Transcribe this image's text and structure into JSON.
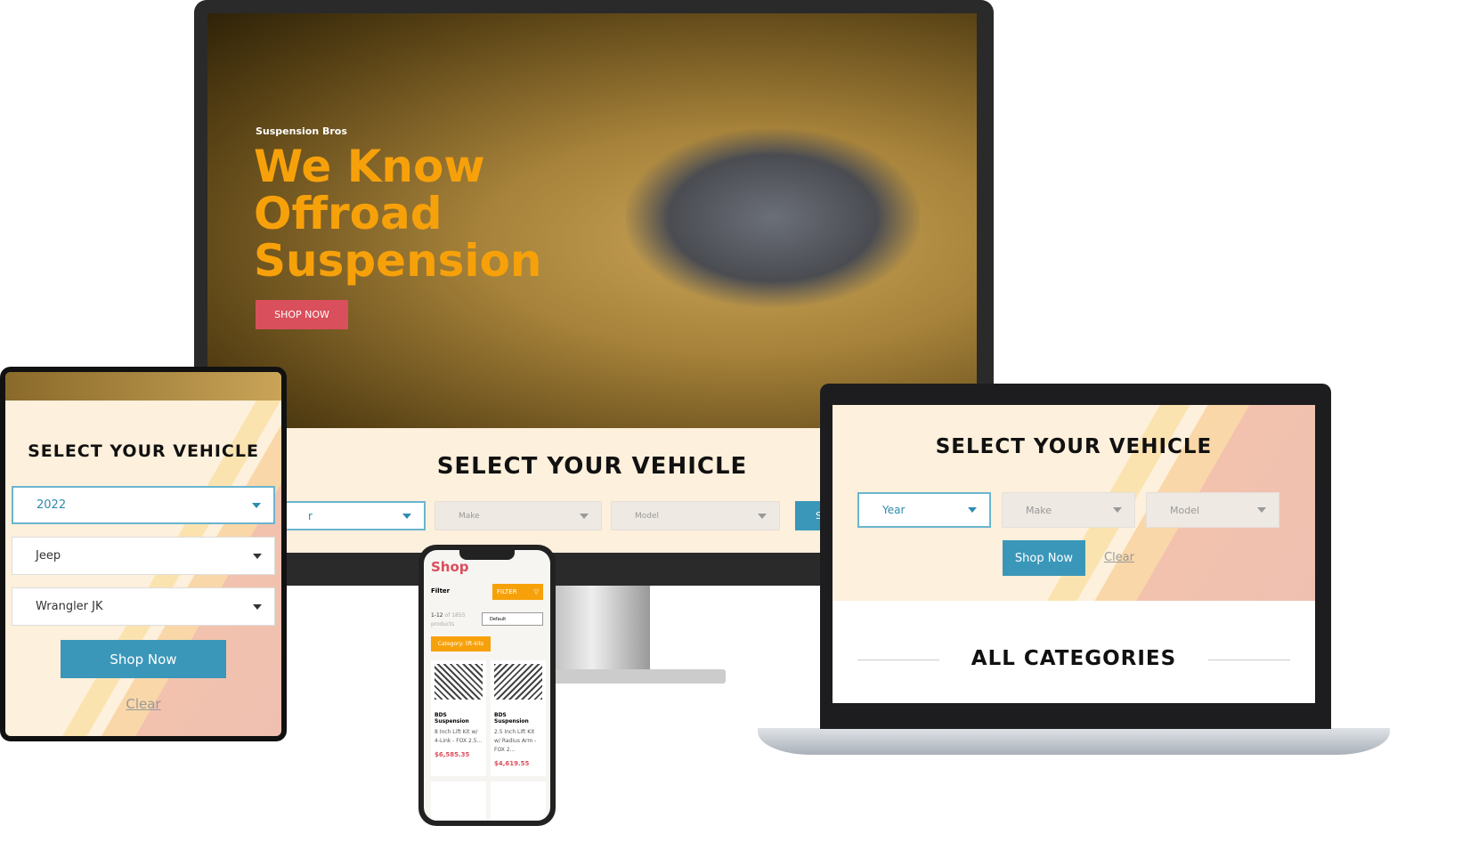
{
  "monitor": {
    "brand": "Suspension Bros",
    "headline": [
      "We Know",
      "Offroad",
      "Suspension"
    ],
    "cta": "SHOP NOW",
    "select_title": "SELECT YOUR VEHICLE",
    "year": "r",
    "make": "Make",
    "model": "Model",
    "shop": "Sh"
  },
  "tablet": {
    "title": "SELECT YOUR VEHICLE",
    "year": "2022",
    "make": "Jeep",
    "model": "Wrangler JK",
    "shop": "Shop Now",
    "clear": "Clear"
  },
  "laptop": {
    "title": "SELECT YOUR VEHICLE",
    "year": "Year",
    "make": "Make",
    "model": "Model",
    "shop": "Shop Now",
    "clear": "Clear",
    "categories": "ALL CATEGORIES"
  },
  "phone": {
    "title": "Shop",
    "filter_label": "Filter",
    "filter_btn": "FILTER",
    "count_a": "1-12",
    "count_b": "of 1855 products",
    "sort": "Default",
    "category": "Category: lift-kits",
    "products": [
      {
        "brand": "BDS Suspension",
        "name": "8 Inch Lift Kit w/ 4-Link - FOX 2.5...",
        "price": "$6,585.35"
      },
      {
        "brand": "BDS Suspension",
        "name": "2.5 Inch Lift Kit w/ Radius Arm - FOX 2...",
        "price": "$4,619.55"
      }
    ]
  },
  "colors": {
    "accent": "#f7a10a",
    "red": "#d94f5c",
    "blue": "#3a97b9"
  }
}
